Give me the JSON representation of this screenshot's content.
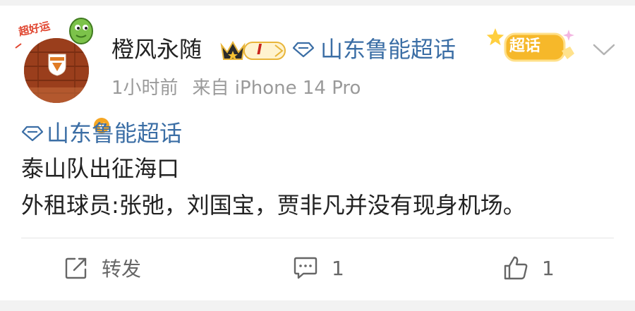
{
  "post": {
    "author": {
      "name": "橙风永随",
      "level": "I",
      "avatar_sticker": "超好运",
      "verified_mark": "v"
    },
    "topic_link": "山东鲁能超话",
    "supertopic_badge": "超话",
    "meta": {
      "time": "1小时前",
      "source": "来自 iPhone 14 Pro"
    },
    "body": {
      "topic": "山东鲁能超话",
      "lines": [
        "泰山队出征海口",
        "外租球员:张弛，刘国宝，贾非凡并没有现身机场。"
      ]
    },
    "actions": {
      "repost_label": "转发",
      "comment_count": "1",
      "like_count": "1"
    }
  },
  "colors": {
    "link": "#3b6ea5",
    "text": "#222222",
    "muted": "#9a9a9a",
    "verified": "#f5a623",
    "supertopic": "#f6b82a"
  }
}
